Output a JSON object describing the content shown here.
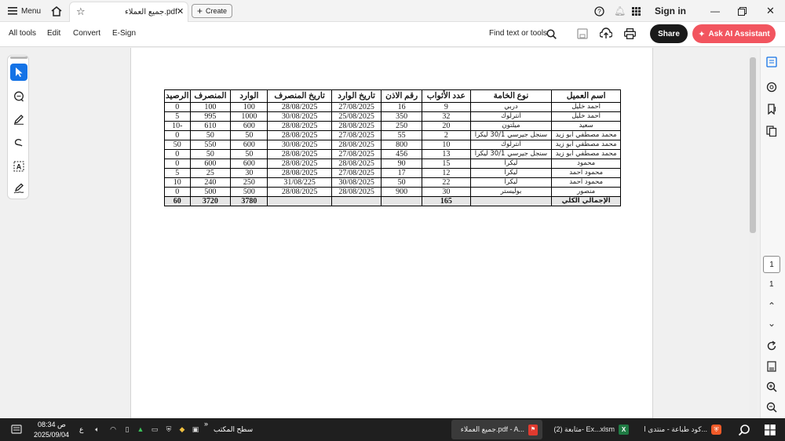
{
  "tabbar": {
    "menu_label": "Menu",
    "doc_tab_title": "جميع العملاء.pdf",
    "create_label": "Create",
    "sign_in": "Sign in"
  },
  "toolbar": {
    "all_tools": "All tools",
    "edit": "Edit",
    "convert": "Convert",
    "esign": "E-Sign",
    "find": "Find text or tools",
    "share": "Share",
    "ai_assistant": "Ask AI Assistant"
  },
  "table": {
    "headers": [
      "اسم العميل",
      "نوع الخامة",
      "عدد الأثواب",
      "رقم الاذن",
      "تاريخ الوارد",
      "تاريخ المنصرف",
      "الوارد",
      "المنصرف",
      "الرصيد"
    ],
    "rows": [
      [
        "احمد خليل",
        "دربي",
        "9",
        "16",
        "27/08/2025",
        "28/08/2025",
        "100",
        "100",
        "0"
      ],
      [
        "احمد خليل",
        "انترلوك",
        "32",
        "350",
        "25/08/2025",
        "30/08/2025",
        "1000",
        "995",
        "5"
      ],
      [
        "سعيد",
        "ميلتون",
        "20",
        "250",
        "28/08/2025",
        "28/08/2025",
        "600",
        "610",
        "-10"
      ],
      [
        "محمد مصطفي ابو زيد",
        "سنجل جيرسي 30/1 ليكرا",
        "2",
        "55",
        "27/08/2025",
        "28/08/2025",
        "50",
        "50",
        "0"
      ],
      [
        "محمد مصطفي ابو زيد",
        "انترلوك",
        "10",
        "800",
        "28/08/2025",
        "30/08/2025",
        "600",
        "550",
        "50"
      ],
      [
        "محمد مصطفي ابو زيد",
        "سنجل جيرسي 30/1 ليكرا",
        "13",
        "456",
        "27/08/2025",
        "28/08/2025",
        "50",
        "50",
        "0"
      ],
      [
        "محمود",
        "ليكرا",
        "15",
        "90",
        "28/08/2025",
        "28/08/2025",
        "600",
        "600",
        "0"
      ],
      [
        "محمود احمد",
        "ليكرا",
        "12",
        "17",
        "27/08/2025",
        "28/08/2025",
        "30",
        "25",
        "5"
      ],
      [
        "محمود احمد",
        "ليكرا",
        "22",
        "50",
        "30/08/2025",
        "31/08/225",
        "250",
        "240",
        "10"
      ],
      [
        "منصور",
        "بوليستر",
        "30",
        "900",
        "28/08/2025",
        "28/08/2025",
        "500",
        "500",
        "0"
      ]
    ],
    "total": {
      "label": "الإجمالي الكلي",
      "pieces": "165",
      "incoming": "3780",
      "outgoing": "3720",
      "balance": "60"
    }
  },
  "pagination": {
    "current": "1",
    "total": "1"
  },
  "taskbar": {
    "apps": [
      {
        "label": "كود طباعة - منتدى ا...",
        "icon": "browser-icon"
      },
      {
        "label": "متابعة (2)- Ex...xlsm",
        "icon": "excel-icon"
      },
      {
        "label": "جميع العملاء.pdf - A...",
        "icon": "pdf-icon"
      }
    ],
    "desktop_label": "سطح المكتب",
    "time": "08:34 ص",
    "date": "2025/09/04",
    "lang": "ع"
  },
  "colors": {
    "accent_ai": "#f2555f",
    "share_bg": "#1a1a1a",
    "rail_active": "#1473e6",
    "taskbar": "#1f1f1f"
  }
}
